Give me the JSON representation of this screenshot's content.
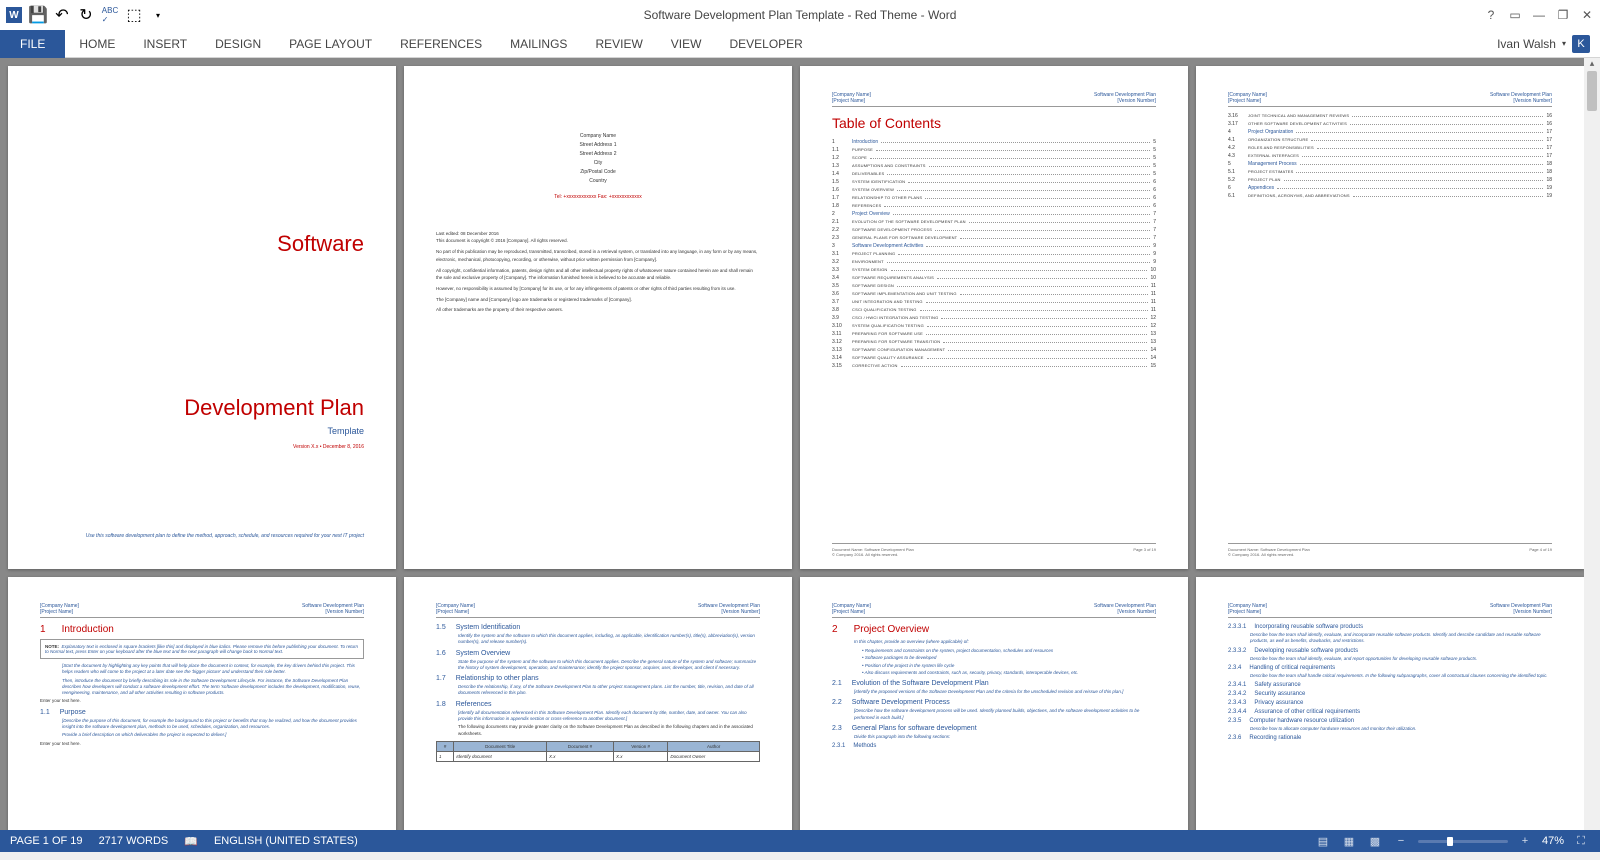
{
  "titlebar": {
    "title": "Software Development Plan Template - Red Theme - Word"
  },
  "ribbon": {
    "file": "FILE",
    "tabs": [
      "HOME",
      "INSERT",
      "DESIGN",
      "PAGE LAYOUT",
      "REFERENCES",
      "MAILINGS",
      "REVIEW",
      "VIEW",
      "DEVELOPER"
    ]
  },
  "user": {
    "name": "Ivan Walsh",
    "initial": "K"
  },
  "status": {
    "page": "PAGE 1 OF 19",
    "words": "2717 WORDS",
    "lang": "ENGLISH (UNITED STATES)",
    "zoom": "47%"
  },
  "page1": {
    "title1": "Software",
    "title2": "Development Plan",
    "subtitle": "Template",
    "version": "Version X.x • December 8, 2016",
    "foot": "Use this software development plan to define the method, approach, schedule, and resources required for your next IT project"
  },
  "page2": {
    "addr": [
      "Company Name",
      "Street Address 1",
      "Street Address 2",
      "City",
      "Zip/Postal Code",
      "Country"
    ],
    "tel": "Tel: +xxxxxxxxxxxx Fax: +xxxxxxxxxxxx",
    "legal1": "Last edited: 08 December 2016",
    "legal2": "This document is copyright © 2016 [Company]. All rights reserved.",
    "legal3": "No part of this publication may be reproduced, transmitted, transcribed, stored in a retrieval system, or translated into any language, in any form or by any means, electronic, mechanical, photocopying, recording, or otherwise, without prior written permission from [Company].",
    "legal4": "All copyright, confidential information, patents, design rights and all other intellectual property rights of whatsoever nature contained herein are and shall remain the sole and exclusive property of [Company]. The information furnished herein is believed to be accurate and reliable.",
    "legal5": "However, no responsibility is assumed by [Company] for its use, or for any infringements of patents or other rights of third parties resulting from its use.",
    "legal6": "The [Company] name and [Company] logo are trademarks or registered trademarks of [Company].",
    "legal7": "All other trademarks are the property of their respective owners."
  },
  "hdr": {
    "company": "[Company Name]",
    "project": "[Project Name]",
    "doc": "Software Development Plan",
    "ver": "[Version Number]"
  },
  "toc": {
    "title": "Table of Contents",
    "items": [
      {
        "n": "1",
        "t": "Introduction",
        "p": "5",
        "m": 1
      },
      {
        "n": "1.1",
        "t": "PURPOSE",
        "p": "5"
      },
      {
        "n": "1.2",
        "t": "SCOPE",
        "p": "5"
      },
      {
        "n": "1.3",
        "t": "ASSUMPTIONS AND CONSTRAINTS",
        "p": "5"
      },
      {
        "n": "1.4",
        "t": "DELIVERABLES",
        "p": "5"
      },
      {
        "n": "1.5",
        "t": "SYSTEM IDENTIFICATION",
        "p": "6"
      },
      {
        "n": "1.6",
        "t": "SYSTEM OVERVIEW",
        "p": "6"
      },
      {
        "n": "1.7",
        "t": "RELATIONSHIP TO OTHER PLANS",
        "p": "6"
      },
      {
        "n": "1.8",
        "t": "REFERENCES",
        "p": "6"
      },
      {
        "n": "2",
        "t": "Project Overview",
        "p": "7",
        "m": 1
      },
      {
        "n": "2.1",
        "t": "EVOLUTION OF THE SOFTWARE DEVELOPMENT PLAN",
        "p": "7"
      },
      {
        "n": "2.2",
        "t": "SOFTWARE DEVELOPMENT PROCESS",
        "p": "7"
      },
      {
        "n": "2.3",
        "t": "GENERAL PLANS FOR SOFTWARE DEVELOPMENT",
        "p": "7"
      },
      {
        "n": "3",
        "t": "Software Development Activities",
        "p": "9",
        "m": 1
      },
      {
        "n": "3.1",
        "t": "PROJECT PLANNING",
        "p": "9"
      },
      {
        "n": "3.2",
        "t": "ENVIRONMENT",
        "p": "9"
      },
      {
        "n": "3.3",
        "t": "SYSTEM DESIGN",
        "p": "10"
      },
      {
        "n": "3.4",
        "t": "SOFTWARE REQUIREMENTS ANALYSIS",
        "p": "10"
      },
      {
        "n": "3.5",
        "t": "SOFTWARE DESIGN",
        "p": "11"
      },
      {
        "n": "3.6",
        "t": "SOFTWARE IMPLEMENTATION AND UNIT TESTING",
        "p": "11"
      },
      {
        "n": "3.7",
        "t": "UNIT INTEGRATION AND TESTING",
        "p": "11"
      },
      {
        "n": "3.8",
        "t": "CSCI QUALIFICATION TESTING",
        "p": "11"
      },
      {
        "n": "3.9",
        "t": "CSCI / HWCI INTEGRATION AND TESTING",
        "p": "12"
      },
      {
        "n": "3.10",
        "t": "SYSTEM QUALIFICATION TESTING",
        "p": "12"
      },
      {
        "n": "3.11",
        "t": "PREPARING FOR SOFTWARE USE",
        "p": "13"
      },
      {
        "n": "3.12",
        "t": "PREPARING FOR SOFTWARE TRANSITION",
        "p": "13"
      },
      {
        "n": "3.13",
        "t": "SOFTWARE CONFIGURATION MANAGEMENT",
        "p": "14"
      },
      {
        "n": "3.14",
        "t": "SOFTWARE QUALITY ASSURANCE",
        "p": "14"
      },
      {
        "n": "3.15",
        "t": "CORRECTIVE ACTION",
        "p": "15"
      }
    ],
    "ftr_l": "Document Name: Software Development Plan",
    "ftr_c": "© Company 2016. All rights reserved.",
    "ftr_r3": "Page 3 of 19",
    "ftr_r4": "Page 4 of 19"
  },
  "toc2": {
    "items": [
      {
        "n": "3.16",
        "t": "JOINT TECHNICAL AND MANAGEMENT REVIEWS",
        "p": "16"
      },
      {
        "n": "3.17",
        "t": "OTHER SOFTWARE DEVELOPMENT ACTIVITIES",
        "p": "16"
      },
      {
        "n": "4",
        "t": "Project Organization",
        "p": "17",
        "m": 1
      },
      {
        "n": "4.1",
        "t": "ORGANIZATION STRUCTURE",
        "p": "17"
      },
      {
        "n": "4.2",
        "t": "ROLES AND RESPONSIBILITIES",
        "p": "17"
      },
      {
        "n": "4.3",
        "t": "EXTERNAL INTERFACES",
        "p": "17"
      },
      {
        "n": "5",
        "t": "Management Process",
        "p": "18",
        "m": 1
      },
      {
        "n": "5.1",
        "t": "PROJECT ESTIMATES",
        "p": "18"
      },
      {
        "n": "5.2",
        "t": "PROJECT PLAN",
        "p": "18"
      },
      {
        "n": "6",
        "t": "Appendices",
        "p": "19",
        "m": 1
      },
      {
        "n": "6.1",
        "t": "DEFINITIONS, ACRONYMS, AND ABBREVIATIONS",
        "p": "19"
      }
    ]
  },
  "p5": {
    "h1n": "1",
    "h1": "Introduction",
    "note": "Explanatory text is enclosed in square brackets [like this] and displayed in blue italics. Please remove this before publishing your document. To return to Normal text, press Enter on your keyboard after the blue text and the next paragraph will change back to Normal text.",
    "noteL": "NOTE:",
    "intro1": "[Start the document by highlighting any key points that will help place the document in context, for example, the key drivers behind this project. This helps readers who will come to the project at a later date see the 'bigger picture' and understand their role better.",
    "intro2": "Then, introduce the document by briefly describing its role in the Software Development Lifecycle. For instance, the Software Development Plan describes how developers will conduct a software development effort. The term 'software development' includes the development, modification, reuse, reengineering, maintenance, and all other activities resulting in software products.",
    "etxt": "Enter your text here.",
    "h2n": "1.1",
    "h2": "Purpose",
    "p1": "[Describe the purpose of this document, for example the background to this project or benefits that may be realized, and how the document provides insight into the software development plan, methods to be used, schedules, organization, and resources.",
    "p2": "Provide a brief description on which deliverables the project is expected to deliver.]"
  },
  "p6": {
    "s15n": "1.5",
    "s15": "System Identification",
    "s15b": "Identify the system and the software to which this document applies, including, as applicable, identification number(s), title(s), abbreviation(s), version number(s), and release number(s).",
    "s16n": "1.6",
    "s16": "System Overview",
    "s16b": "State the purpose of the system and the software to which this document applies. Describe the general nature of the system and software; summarize the history of system development, operation, and maintenance; identify the project sponsor, acquirer, user, developer, and client if necessary.",
    "s17n": "1.7",
    "s17": "Relationship to other plans",
    "s17b": "Describe the relationship, if any, of the Software Development Plan to other project management plans. List the number, title, revision, and date of all documents referenced in this plan.",
    "s18n": "1.8",
    "s18": "References",
    "s18b": "[Identify all documentation referenced in this Software Development Plan. Identify each document by title, number, date, and owner. You can also provide this information in appendix section or cross-reference to another document.]",
    "s18c": "The following documents may provide greater clarity on the Software Development Plan as described in the following chapters and in the associated worksheets.",
    "th": [
      "#",
      "Document Title",
      "Document #",
      "Version #",
      "Author"
    ],
    "td": [
      "1",
      "Identify document",
      "X.x",
      "X.x",
      "Document Owner"
    ]
  },
  "p7": {
    "h1n": "2",
    "h1": "Project Overview",
    "lead": "In this chapter, provide an overview (where applicable) of:",
    "b1": "Requirements and constraints on the system, project documentation, schedules and resources",
    "b2": "Software packages to be developed",
    "b3": "Position of the project in the system life cycle",
    "b4": "Also discuss requirements and constraints, such as, security, privacy, standards, interoperable devices, etc.",
    "s21n": "2.1",
    "s21": "Evolution of the Software Development Plan",
    "s21b": "[Identify the proposed versions of the Software Development Plan and the criteria for the unscheduled revision and reissue of this plan.]",
    "s22n": "2.2",
    "s22": "Software Development Process",
    "s22b": "[Describe how the software development process will be used. Identify planned builds, objectives, and the software development activities to be performed in each build.]",
    "s23n": "2.3",
    "s23": "General Plans for software development",
    "s23l": "Divide this paragraph into the following sections:",
    "s231n": "2.3.1",
    "s231": "Methods"
  },
  "p8": {
    "s2331n": "2.3.3.1",
    "s2331": "Incorporating reusable software products",
    "s2331b": "Describe how the team shall identify, evaluate, and incorporate reusable software products. Identify and describe candidate and reusable software products, as well as benefits, drawbacks, and restrictions.",
    "s2332n": "2.3.3.2",
    "s2332": "Developing reusable software products",
    "s2332b": "Describe how the team shall identify, evaluate, and report opportunities for developing reusable software products.",
    "s234n": "2.3.4",
    "s234": "Handling of critical requirements",
    "s234b": "Describe how the team shall handle critical requirements. In the following subparagraphs, cover all contractual clauses concerning the identified topic.",
    "s2341n": "2.3.4.1",
    "s2341": "Safety assurance",
    "s2342n": "2.3.4.2",
    "s2342": "Security assurance",
    "s2343n": "2.3.4.3",
    "s2343": "Privacy assurance",
    "s2344n": "2.3.4.4",
    "s2344": "Assurance of other critical requirements",
    "s235n": "2.3.5",
    "s235": "Computer hardware resource utilization",
    "s235b": "Describe how to allocate computer hardware resources and monitor their utilization.",
    "s236n": "2.3.6",
    "s236": "Recording rationale"
  }
}
